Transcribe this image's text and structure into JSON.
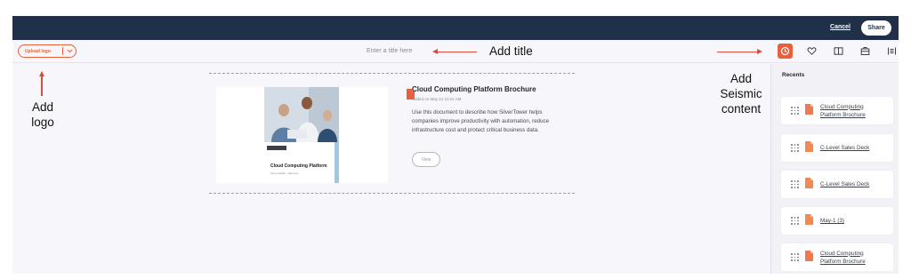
{
  "header": {
    "cancel_label": "Cancel",
    "share_label": "Share"
  },
  "toolbar": {
    "upload_logo_label": "Upload logo",
    "title_placeholder": "Enter a title here",
    "tab_icons": [
      "recent-clock-icon",
      "favorites-heart-icon",
      "library-book-icon",
      "briefcase-icon",
      "fit-content-icon"
    ],
    "active_tab": "recent-clock-icon"
  },
  "annotations": {
    "add_title": "Add title",
    "add_logo_line1": "Add",
    "add_logo_line2": "logo",
    "add_seismic_line1": "Add",
    "add_seismic_line2": "Seismic",
    "add_seismic_line3": "content"
  },
  "document": {
    "title": "Cloud Computing Platform Brochure",
    "date": "Added on May 21 10:21 AM",
    "description": "Use this document to describe how SilverTower helps companies improve productivity with automation, reduce infrastructure cost and protect critical business data.",
    "view_label": "View",
    "thumbnail_title": "Cloud Computing Platform",
    "thumbnail_subtitle": "Some subtitle · date here"
  },
  "recents": {
    "title": "Recents",
    "items": [
      {
        "label": "Cloud Computing Platform Brochure"
      },
      {
        "label": "C-Level Sales Deck"
      },
      {
        "label": "C-Level Sales Deck"
      },
      {
        "label": "May-1 (3)"
      },
      {
        "label": "Cloud Computing Platform Brochure"
      }
    ]
  },
  "colors": {
    "accent": "#e8613c",
    "topbar": "#1f3048",
    "annotation_arrow": "#e04a3a"
  }
}
